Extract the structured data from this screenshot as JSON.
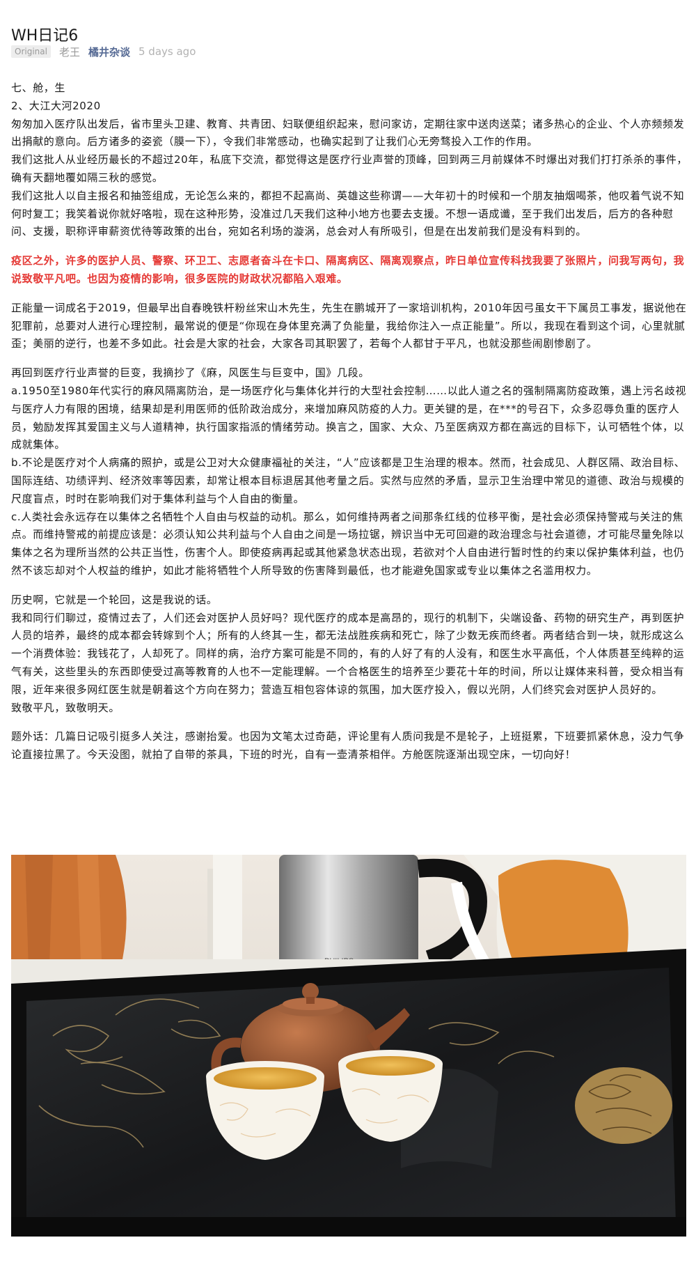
{
  "article": {
    "title": "WH日记6",
    "badge": "Original",
    "author": "老王",
    "account": "橘井杂谈",
    "time": "5 days ago"
  },
  "paragraphs": {
    "p1": "七、舱，生",
    "p2": "2、大江大河2020",
    "p3": "匆匆加入医疗队出发后，省市里头卫建、教育、共青团、妇联便组织起来，慰问家访，定期往家中送肉送菜；诸多热心的企业、个人亦频频发出捐献的意向。后方诸多的姿瓷（膜一下），令我们非常感动，也确实起到了让我们心无旁骛投入工作的作用。",
    "p4": "我们这批人从业经历最长的不超过20年，私底下交流，都觉得这是医疗行业声誉的顶峰，回到两三月前媒体不时爆出对我们打打杀杀的事件，确有天翻地覆如隔三秋的感觉。",
    "p5": "我们这批人以自主报名和抽签组成，无论怎么来的，都担不起高尚、英雄这些称谓——大年初十的时候和一个朋友抽烟喝茶，他叹着气说不知何时复工；我笑着说你就好咯啦，现在这种形势，没准过几天我们这种小地方也要去支援。不想一语成谶，至于我们出发后，后方的各种慰问、支援，职称评审薪资优待等政策的出台，宛如名利场的漩涡，总会对人有所吸引，但是在出发前我们是没有料到的。",
    "p6": "疫区之外，许多的医护人员、警察、环卫工、志愿者奋斗在卡口、隔离病区、隔离观察点，昨日单位宣传科找我要了张照片，问我写两句，我说致敬平凡吧。也因为疫情的影响，很多医院的财政状况都陷入艰难。",
    "p7": "正能量一词成名于2019，但最早出自春晚铁杆粉丝宋山木先生，先生在鹏城开了一家培训机构，2010年因弓虽女干下属员工事发，据说他在犯罪前，总要对人进行心理控制，最常说的便是“你现在身体里充满了负能量，我给你注入一点正能量”。所以，我现在看到这个词，心里就腻歪；美丽的逆行，也差不多如此。社会是大家的社会，大家各司其职罢了，若每个人都甘于平凡，也就没那些闹剧惨剧了。",
    "p8": "再回到医疗行业声誉的巨变，我摘抄了《麻，风医生与巨变中，国》几段。",
    "p9": "a.1950至1980年代实行的麻风隔离防治，是一场医疗化与集体化并行的大型社会控制……以此人道之名的强制隔离防疫政策，遇上污名歧视与医疗人力有限的困境，结果却是利用医师的低阶政治成分，来增加麻风防疫的人力。更关键的是，在***的号召下，众多忍辱负重的医疗人员，勉励发挥其爱国主义与人道精神，执行国家指派的情绪劳动。换言之，国家、大众、乃至医病双方都在高远的目标下，认可牺牲个体，以成就集体。",
    "p10": "b.不论是医疗对个人病痛的照护，或是公卫对大众健康福祉的关注，“人”应该都是卫生治理的根本。然而，社会成见、人群区隔、政治目标、国际连结、功绩评判、经济效率等因素，却常让根本目标退居其他考量之后。实然与应然的矛盾，显示卫生治理中常见的道德、政治与规模的尺度盲点，时时在影响我们对于集体利益与个人自由的衡量。",
    "p11": "c.人类社会永远存在以集体之名牺牲个人自由与权益的动机。那么，如何维持两者之间那条红线的位移平衡，是社会必须保持警戒与关注的焦点。而维持警戒的前提应该是：必须认知公共利益与个人自由之间是一场拉锯，辨识当中无可回避的政治理念与社会道德，才可能尽量免除以集体之名为理所当然的公共正当性，伤害个人。即使疫病再起或其他紧急状态出现，若欲对个人自由进行暂时性的约束以保护集体利益，也仍然不该忘却对个人权益的维护，如此才能将牺牲个人所导致的伤害降到最低，也才能避免国家或专业以集体之名滥用权力。",
    "p12": "历史啊，它就是一个轮回，这是我说的话。",
    "p13": "我和同行们聊过，疫情过去了，人们还会对医护人员好吗？现代医疗的成本是高昂的，现行的机制下，尖端设备、药物的研究生产，再到医护人员的培养，最终的成本都会转嫁到个人；所有的人终其一生，都无法战胜疾病和死亡，除了少数无疾而终者。两者结合到一块，就形成这么一个消费体验：我钱花了，人却死了。同样的病，治疗方案可能是不同的，有的人好了有的人没有，和医生水平高低，个人体质甚至纯粹的运气有关，这些里头的东西即使受过高等教育的人也不一定能理解。一个合格医生的培养至少要花十年的时间，所以让媒体来科普，受众相当有限，近年来很多网红医生就是朝着这个方向在努力；营造互相包容体谅的氛围，加大医疗投入，假以光阴，人们终究会对医护人员好的。",
    "p14": "致敬平凡，致敬明天。",
    "p15": "题外话：几篇日记吸引挺多人关注，感谢抬爱。也因为文笔太过奇葩，评论里有人质问我是不是轮子，上班挺累，下班要抓紧休息，没力气争论直接拉黑了。今天没图，就拍了自带的茶具，下班的时光，自有一壶清茶相伴。方舱医院逐渐出现空床，一切向好！"
  },
  "photo": {
    "kettle_brand": "PHILIPS",
    "colors": {
      "tray": "#1c1c1c",
      "teapot": "#9c5a36",
      "tea": "#e3a73a",
      "curtain": "#d27a3a",
      "chair": "#f2f0ea"
    }
  },
  "colors": {
    "accent_link": "#576b95",
    "highlight_red": "#e53935",
    "muted": "#9a9a9a"
  }
}
